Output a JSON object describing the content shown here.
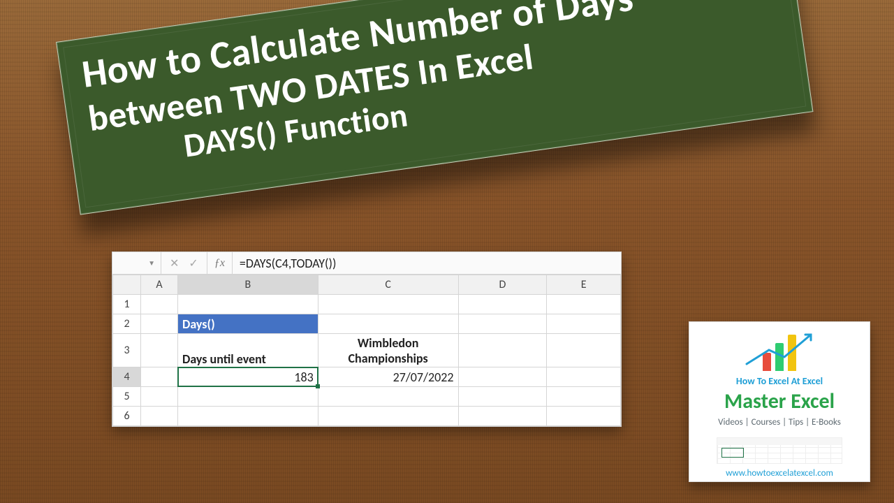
{
  "banner": {
    "line1": "How to Calculate Number of Days",
    "line2": "between TWO DATES In Excel",
    "line3": "DAYS() Function"
  },
  "excel": {
    "formula": "=DAYS(C4,TODAY())",
    "columns": [
      "A",
      "B",
      "C",
      "D",
      "E"
    ],
    "row_numbers": [
      "1",
      "2",
      "3",
      "4",
      "5",
      "6"
    ],
    "b2": "Days()",
    "b3": "Days until event",
    "c3": "Wimbledon Championships",
    "b4": "183",
    "c4": "27/07/2022",
    "selected_row": "4"
  },
  "card": {
    "tag": "How To Excel At Excel",
    "title": "Master Excel",
    "subtitle": "Videos | Courses | Tips | E-Books",
    "url": "www.howtoexcelatexcel.com"
  }
}
